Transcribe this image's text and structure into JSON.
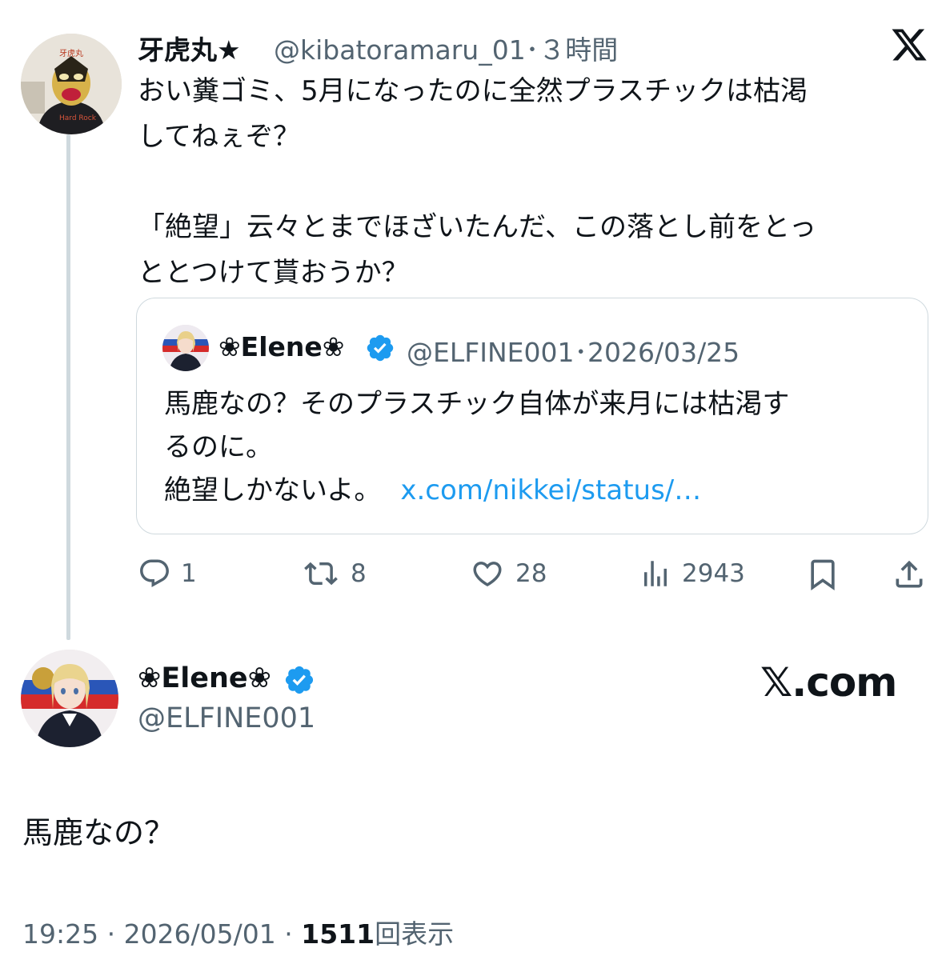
{
  "parent_tweet": {
    "name": "牙虎丸★",
    "handle_time": "@kibatoramaru_01･３時間",
    "text_lines": [
      "おい糞ゴミ、5月になったのに全然プラスチックは枯渇",
      "してねぇぞ？",
      "「絶望」云々とまでほざいたんだ、この落とし前をとっ",
      "ととつけて貰おうか？"
    ],
    "actions": {
      "replies": "1",
      "retweets": "8",
      "likes": "28",
      "views": "2943"
    }
  },
  "quoted_tweet": {
    "name": "❀Elene❀",
    "handle_date": "@ELFINE001･2026/03/25",
    "text_lines": [
      "馬鹿なの？そのプラスチック自体が来月には枯渇す",
      "るのに。",
      "絶望しかないよ。"
    ],
    "link": "x.com/nikkei/status/…"
  },
  "main_tweet": {
    "name": "❀Elene❀",
    "handle": "@ELFINE001",
    "watermark": "𝕏.com",
    "text": "馬鹿なの？",
    "meta_time": "19:25 · 2026/05/01 · ",
    "meta_views": "1511",
    "meta_views_label": "回表示"
  },
  "icons": {
    "top_right": "x-logo-icon",
    "verified": "verified-badge-icon",
    "reply": "reply-icon",
    "retweet": "retweet-icon",
    "like": "heart-icon",
    "views": "views-icon",
    "bookmark": "bookmark-icon",
    "share": "share-icon"
  },
  "colors": {
    "text": "#0f1419",
    "secondary": "#536471",
    "link": "#1d9bf0",
    "verified": "#1d9bf0",
    "border": "#cfd9de"
  }
}
